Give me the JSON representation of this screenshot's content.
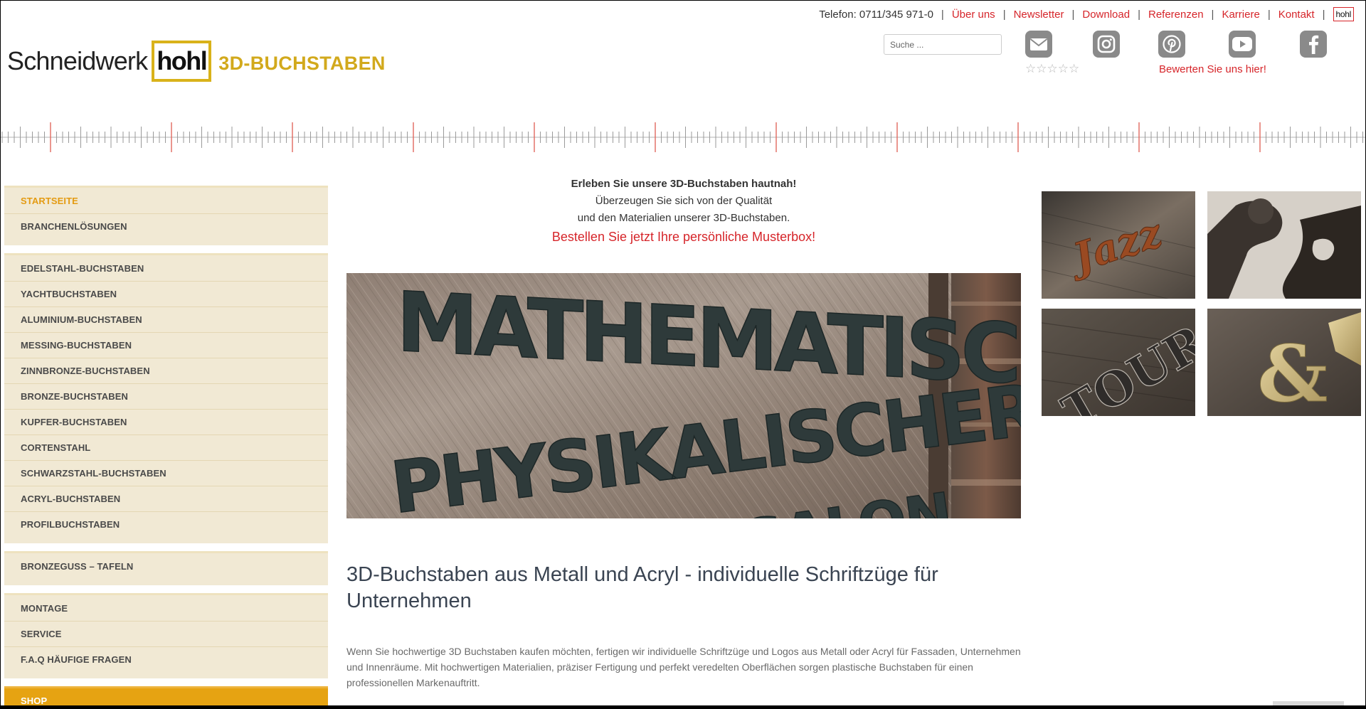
{
  "header": {
    "phone": "Telefon: 0711/345 971-0",
    "nav": [
      {
        "label": "Über uns"
      },
      {
        "label": "Newsletter"
      },
      {
        "label": "Download"
      },
      {
        "label": "Referenzen"
      },
      {
        "label": "Karriere"
      },
      {
        "label": "Kontakt"
      }
    ],
    "hohl_link": "hohl",
    "logo": {
      "wordmark": "Schneidwerk",
      "brand": "hohl",
      "tagline": "3D-BUCHSTABEN"
    },
    "search_placeholder": "Suche ...",
    "social": [
      {
        "name": "mail-icon"
      },
      {
        "name": "instagram-icon"
      },
      {
        "name": "pinterest-icon"
      },
      {
        "name": "youtube-icon"
      },
      {
        "name": "facebook-icon"
      }
    ],
    "rating_stars": "☆☆☆☆☆",
    "rating_value": 0,
    "rate_label": "Bewerten Sie uns hier!"
  },
  "sidebar": {
    "groups": [
      {
        "items": [
          "STARTSEITE",
          "BRANCHENLÖSUNGEN"
        ],
        "active": 0
      },
      {
        "items": [
          "EDELSTAHL-BUCHSTABEN",
          "YACHTBUCHSTABEN",
          "ALUMINIUM-BUCHSTABEN",
          "MESSING-BUCHSTABEN",
          "ZINNBRONZE-BUCHSTABEN",
          "BRONZE-BUCHSTABEN",
          "KUPFER-BUCHSTABEN",
          "CORTENSTAHL",
          "SCHWARZSTAHL-BUCHSTABEN",
          "ACRYL-BUCHSTABEN",
          "PROFILBUCHSTABEN"
        ]
      },
      {
        "items": [
          "BRONZEGUSS – TAFELN"
        ]
      },
      {
        "items": [
          "MONTAGE",
          "SERVICE",
          "F.A.Q HÄUFIGE FRAGEN"
        ]
      },
      {
        "items": [
          "SHOP"
        ],
        "shop": true
      }
    ]
  },
  "intro": {
    "line1": "Erleben Sie unsere 3D-Buchstaben hautnah!",
    "line2": "Überzeugen Sie sich von der Qualität",
    "line3": "und den Materialien unserer 3D-Buchstaben.",
    "cta": "Bestellen Sie jetzt Ihre persönliche Musterbox!"
  },
  "hero": {
    "line1": "MATHEMATISCH-",
    "line2": "PHYSIKALISCHER",
    "line3": "SALON"
  },
  "thumbnails": {
    "jazz": "Jazz",
    "tour": "TOUR",
    "amp": "&"
  },
  "content": {
    "heading": "3D-Buchstaben aus Metall und Acryl - individuelle Schriftzüge für Unternehmen",
    "paragraph": "Wenn Sie hochwertige 3D Buchstaben kaufen möchten, fertigen wir individuelle Schriftzüge und Logos aus Metall oder Acryl für Fassaden, Unternehmen und Innenräume. Mit hochwertigen Materialien, präziser Fertigung und perfekt veredelten Oberflächen sorgen plastische Buchstaben für einen professionellen Markenauftritt."
  },
  "colors": {
    "accent_red": "#d6252a",
    "gold": "#d2a91c",
    "sidebar_bg": "#f1e9d4",
    "shop_orange": "#e6a312"
  }
}
